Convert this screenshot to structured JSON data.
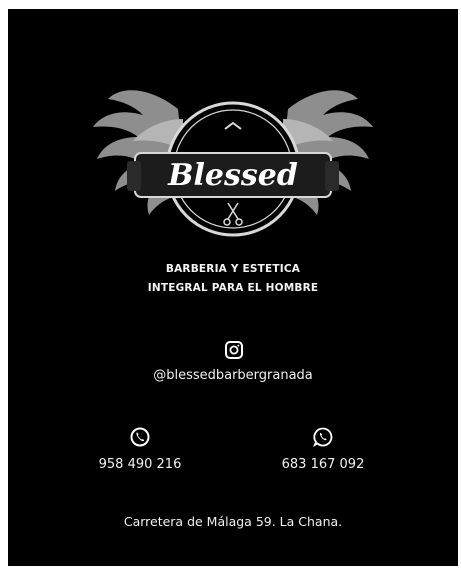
{
  "brand": {
    "name": "Blessed"
  },
  "tagline": {
    "line1": "BARBERIA Y ESTETICA",
    "line2": "INTEGRAL PARA EL HOMBRE"
  },
  "instagram": {
    "icon": "instagram-icon",
    "handle": "@blessedbarbergranada"
  },
  "contacts": [
    {
      "icon": "phone-icon",
      "number": "958 490 216"
    },
    {
      "icon": "whatsapp-icon",
      "number": "683 167 092"
    }
  ],
  "address": "Carretera  de Málaga 59. La Chana.",
  "colors": {
    "background": "#000000",
    "wings": "#9a9a9a",
    "text": "#ffffff"
  }
}
